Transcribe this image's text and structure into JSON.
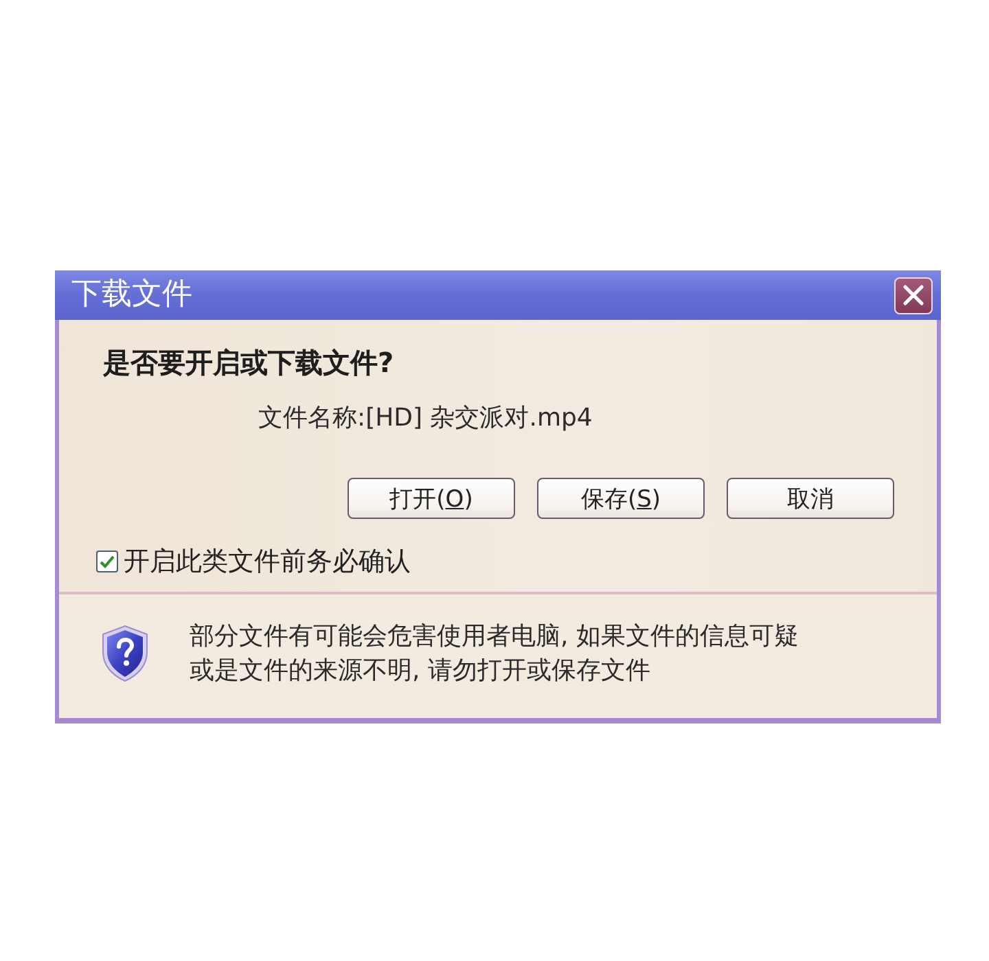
{
  "window": {
    "title": "下载文件"
  },
  "prompt": "是否要开启或下载文件?",
  "file_name": "文件名称:[HD] 杂交派对.mp4",
  "buttons": [
    {
      "parts": [
        {
          "text": "打开(",
          "underlined": false
        },
        {
          "text": "O",
          "underlined": true
        },
        {
          "text": ")",
          "underlined": false
        }
      ]
    },
    {
      "parts": [
        {
          "text": "保存(",
          "underlined": false
        },
        {
          "text": "S",
          "underlined": true
        },
        {
          "text": ")",
          "underlined": false
        }
      ]
    },
    {
      "parts": [
        {
          "text": "取消",
          "underlined": false
        }
      ]
    }
  ],
  "confirm_checkbox": {
    "label": "开启此类文件前务必确认",
    "checked": true
  },
  "warning": {
    "lines": [
      "部分文件有可能会危害使用者电脑, 如果文件的信息可疑",
      "或是文件的来源不明, 请勿打开或保存文件"
    ]
  }
}
